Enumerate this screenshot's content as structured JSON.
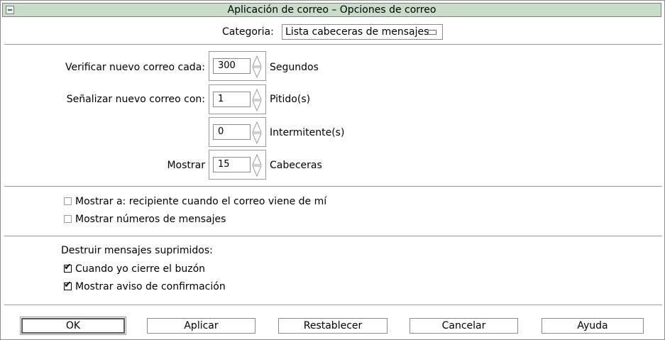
{
  "window": {
    "title": "Aplicación de correo – Opciones de correo"
  },
  "category": {
    "label": "Categoria:",
    "value": "Lista cabeceras de mensajes"
  },
  "options": {
    "check_interval": {
      "label": "Verificar nuevo correo cada:",
      "value": "300",
      "unit": "Segundos"
    },
    "signal_beeps": {
      "label": "Señalizar nuevo correo con:",
      "value": "1",
      "unit": "Pitido(s)"
    },
    "signal_flashes": {
      "value": "0",
      "unit": "Intermitente(s)"
    },
    "show_headers": {
      "label": "Mostrar",
      "value": "15",
      "unit": "Cabeceras"
    }
  },
  "display_options": [
    {
      "label": "Mostrar a: recipiente cuando el correo viene de mí",
      "checked": false
    },
    {
      "label": "Mostrar números de mensajes",
      "checked": false
    }
  ],
  "destroy": {
    "heading": "Destruir mensajes suprimidos:",
    "items": [
      {
        "label": "Cuando yo cierre el buzón",
        "checked": true
      },
      {
        "label": "Mostrar aviso de confirmación",
        "checked": true
      }
    ]
  },
  "buttons": {
    "ok": "OK",
    "apply": "Aplicar",
    "reset": "Restablecer",
    "cancel": "Cancelar",
    "help": "Ayuda"
  }
}
